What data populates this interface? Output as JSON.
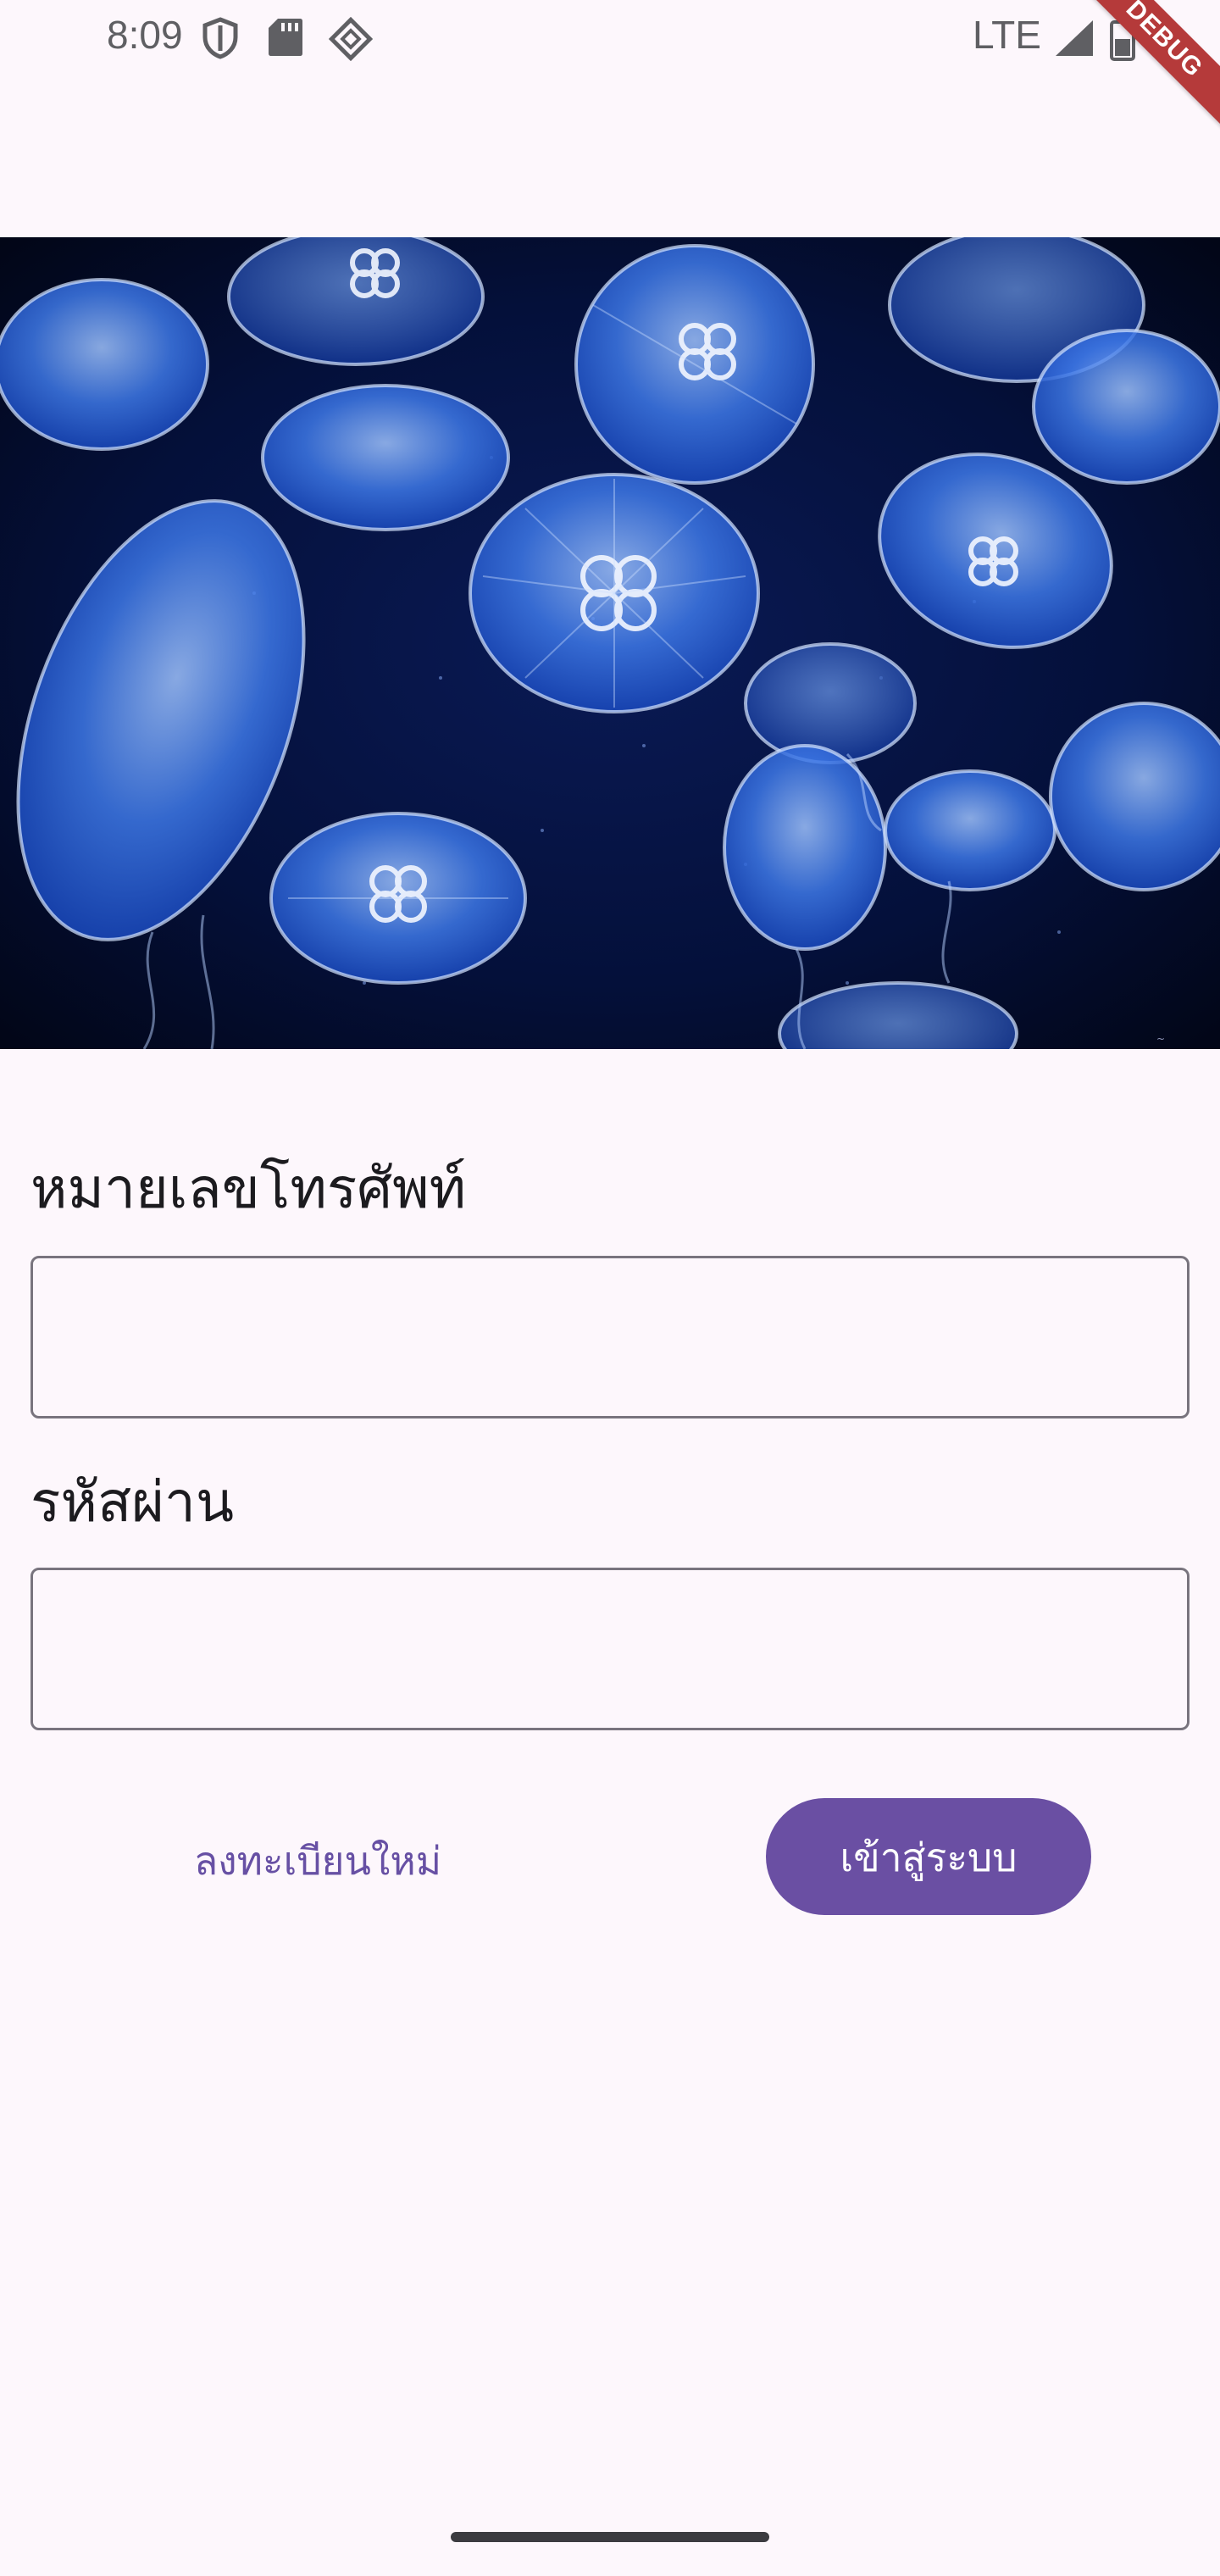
{
  "status_bar": {
    "time": "8:09",
    "network": "LTE",
    "icons": [
      "shield-icon",
      "sd-card-icon",
      "app-diamond-icon",
      "signal-icon",
      "battery-icon"
    ]
  },
  "debug_banner": "DEBUG",
  "hero_image": {
    "subject": "jellyfish-photo"
  },
  "form": {
    "phone_label": "หมายเลขโทรศัพท์",
    "phone_value": "",
    "password_label": "รหัสผ่าน",
    "password_value": ""
  },
  "actions": {
    "register_label": "ลงทะเบียนใหม่",
    "login_label": "เข้าสู่ระบบ"
  },
  "colors": {
    "background": "#fdf7fc",
    "primary": "#6a4fa3",
    "outline": "#79747e",
    "debug_banner": "#b53a3a"
  }
}
